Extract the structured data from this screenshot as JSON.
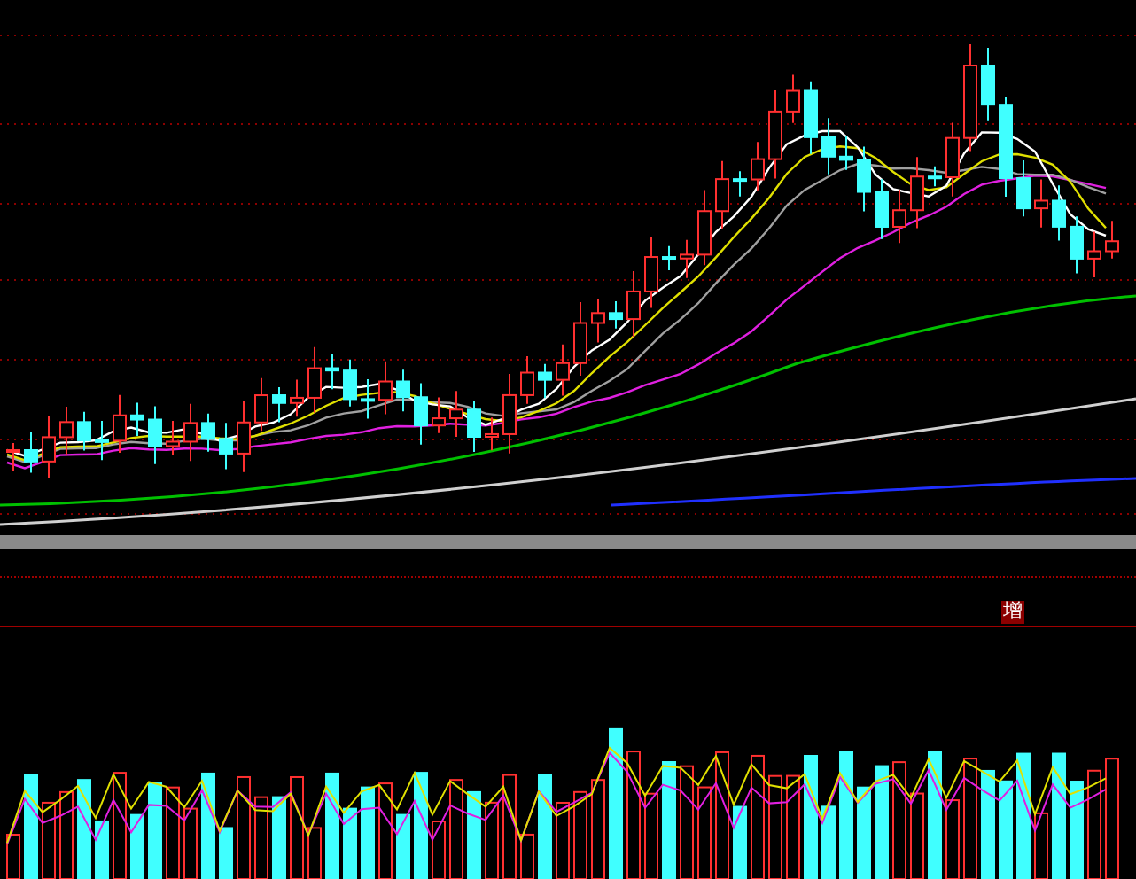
{
  "volume_panel": {
    "badge": "增"
  }
}
